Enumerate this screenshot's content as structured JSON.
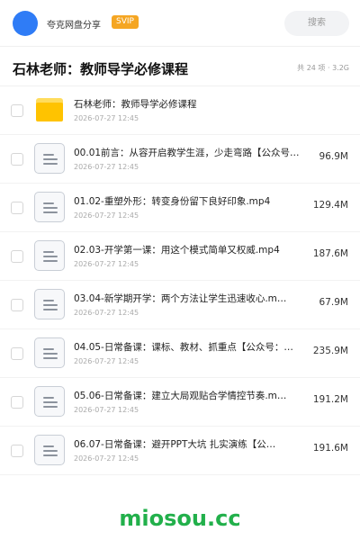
{
  "header": {
    "share_name": "夸克网盘分享",
    "badge": "SVIP",
    "search_label": "搜索",
    "avatar_color": "#2f7cf6",
    "badge_color": "#f5a623"
  },
  "folder": {
    "title": "石林老师：教师导学必修课程",
    "summary": "共 24 项 · 3.2G"
  },
  "files": [
    {
      "name": "石林老师：教师导学必修课程",
      "date": "2026-07-27 12:45",
      "size": "",
      "icon": "folder-icon"
    },
    {
      "name": "00.01前言：从容开启教学生涯，少走弯路【公众号…",
      "date": "2026-07-27 12:45",
      "size": "96.9M",
      "icon": "document-icon"
    },
    {
      "name": "01.02-重塑外形：转变身份留下良好印象.mp4",
      "date": "2026-07-27 12:45",
      "size": "129.4M",
      "icon": "document-icon"
    },
    {
      "name": "02.03-开学第一课：用这个模式简单又权威.mp4",
      "date": "2026-07-27 12:45",
      "size": "187.6M",
      "icon": "document-icon"
    },
    {
      "name": "03.04-新学期开学：两个方法让学生迅速收心.m…",
      "date": "2026-07-27 12:45",
      "size": "67.9M",
      "icon": "document-icon"
    },
    {
      "name": "04.05-日常备课：课标、教材、抓重点【公众号：…",
      "date": "2026-07-27 12:45",
      "size": "235.9M",
      "icon": "document-icon"
    },
    {
      "name": "05.06-日常备课：建立大局观贴合学情控节奏.m…",
      "date": "2026-07-27 12:45",
      "size": "191.2M",
      "icon": "document-icon"
    },
    {
      "name": "06.07-日常备课：避开PPT大坑 扎实演练【公…",
      "date": "2026-07-27 12:45",
      "size": "191.6M",
      "icon": "document-icon"
    }
  ],
  "watermark": "miosou.cc",
  "watermark_color": "#22b04b"
}
